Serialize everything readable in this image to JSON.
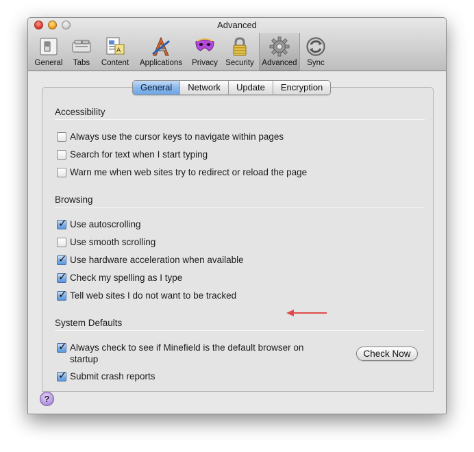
{
  "window": {
    "title": "Advanced"
  },
  "toolbar": {
    "items": [
      {
        "label": "General",
        "icon": "general-switch-icon"
      },
      {
        "label": "Tabs",
        "icon": "tabs-icon"
      },
      {
        "label": "Content",
        "icon": "content-icon"
      },
      {
        "label": "Applications",
        "icon": "applications-icon"
      },
      {
        "label": "Privacy",
        "icon": "privacy-mask-icon"
      },
      {
        "label": "Security",
        "icon": "padlock-icon"
      },
      {
        "label": "Advanced",
        "icon": "gear-icon"
      },
      {
        "label": "Sync",
        "icon": "sync-icon"
      }
    ],
    "active": "Advanced"
  },
  "tabs": {
    "items": [
      "General",
      "Network",
      "Update",
      "Encryption"
    ],
    "active": "General"
  },
  "sections": {
    "accessibility": {
      "title": "Accessibility",
      "items": [
        {
          "label": "Always use the cursor keys to navigate within pages",
          "checked": false
        },
        {
          "label": "Search for text when I start typing",
          "checked": false
        },
        {
          "label": "Warn me when web sites try to redirect or reload the page",
          "checked": false
        }
      ]
    },
    "browsing": {
      "title": "Browsing",
      "items": [
        {
          "label": "Use autoscrolling",
          "checked": true
        },
        {
          "label": "Use smooth scrolling",
          "checked": false
        },
        {
          "label": "Use hardware acceleration when available",
          "checked": true
        },
        {
          "label": "Check my spelling as I type",
          "checked": true
        },
        {
          "label": "Tell web sites I do not want to be tracked",
          "checked": true
        }
      ]
    },
    "system_defaults": {
      "title": "System Defaults",
      "items": [
        {
          "label": "Always check to see if Minefield is the default browser on startup",
          "checked": true
        },
        {
          "label": "Submit crash reports",
          "checked": true
        }
      ],
      "check_now_label": "Check Now"
    }
  },
  "help": {
    "label": "?"
  },
  "colors": {
    "arrow": "#e04a4a",
    "active_tab": "#7aaee9"
  }
}
